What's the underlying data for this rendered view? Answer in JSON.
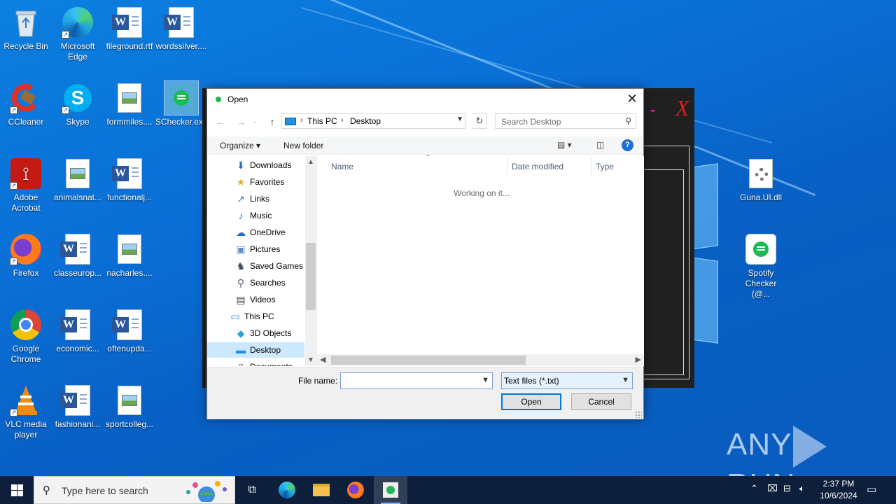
{
  "desktop": {
    "icons": [
      {
        "label": "Recycle Bin",
        "icon": "recycle-bin-icon"
      },
      {
        "label": "Microsoft Edge",
        "icon": "edge-icon"
      },
      {
        "label": "fileground.rtf",
        "icon": "word-doc-icon"
      },
      {
        "label": "wordssilver....",
        "icon": "word-doc-icon"
      },
      {
        "label": "CCleaner",
        "icon": "ccleaner-icon"
      },
      {
        "label": "Skype",
        "icon": "skype-icon"
      },
      {
        "label": "formmiles....",
        "icon": "image-file-icon"
      },
      {
        "label": "SChecker.exe",
        "icon": "spotify-checker-icon"
      },
      {
        "label": "Adobe Acrobat",
        "icon": "acrobat-icon"
      },
      {
        "label": "animalsnat...",
        "icon": "image-file-icon"
      },
      {
        "label": "functionalj...",
        "icon": "word-doc-icon"
      },
      {
        "label": "Firefox",
        "icon": "firefox-icon"
      },
      {
        "label": "classeurop...",
        "icon": "word-doc-icon"
      },
      {
        "label": "nacharles....",
        "icon": "image-file-icon"
      },
      {
        "label": "Google Chrome",
        "icon": "chrome-icon"
      },
      {
        "label": "economic...",
        "icon": "word-doc-icon"
      },
      {
        "label": "oftenupda...",
        "icon": "word-doc-icon"
      },
      {
        "label": "VLC media player",
        "icon": "vlc-icon"
      },
      {
        "label": "fashionani...",
        "icon": "word-doc-icon"
      },
      {
        "label": "sportcolleg...",
        "icon": "image-file-icon"
      },
      {
        "label": "Guna.UI.dll",
        "icon": "dll-gear-icon"
      },
      {
        "label": "Spotify Checker (@...",
        "icon": "spotify-checker-icon"
      }
    ]
  },
  "background_app": {
    "minimize_glyph": "-",
    "close_glyph": "X"
  },
  "dialog": {
    "title": "Open",
    "close_glyph": "✕",
    "nav": {
      "back": "←",
      "forward": "→",
      "recent": "⌄",
      "up": "↑",
      "refresh": "↻"
    },
    "address": {
      "crumbs": [
        "This PC",
        "Desktop"
      ],
      "sep": "›"
    },
    "search_placeholder": "Search Desktop",
    "toolbar": {
      "organize": "Organize ▾",
      "new_folder": "New folder",
      "help": "?"
    },
    "nav_items": [
      {
        "label": "Downloads",
        "icon": "downloads-icon",
        "glyph": "⬇",
        "color": "#1e6fd6",
        "indent": 1,
        "selected": false
      },
      {
        "label": "Favorites",
        "icon": "favorites-icon",
        "glyph": "★",
        "color": "#e8b21c",
        "indent": 1,
        "selected": false
      },
      {
        "label": "Links",
        "icon": "links-icon",
        "glyph": "↗",
        "color": "#2a7ad8",
        "indent": 1,
        "selected": false
      },
      {
        "label": "Music",
        "icon": "music-icon",
        "glyph": "♪",
        "color": "#1e6fd6",
        "indent": 1,
        "selected": false
      },
      {
        "label": "OneDrive",
        "icon": "onedrive-icon",
        "glyph": "☁",
        "color": "#1e6fd6",
        "indent": 1,
        "selected": false
      },
      {
        "label": "Pictures",
        "icon": "pictures-icon",
        "glyph": "▣",
        "color": "#5e8fc7",
        "indent": 1,
        "selected": false
      },
      {
        "label": "Saved Games",
        "icon": "saved-games-icon",
        "glyph": "♞",
        "color": "#3a4a5e",
        "indent": 1,
        "selected": false
      },
      {
        "label": "Searches",
        "icon": "searches-icon",
        "glyph": "⚲",
        "color": "#566577",
        "indent": 1,
        "selected": false
      },
      {
        "label": "Videos",
        "icon": "videos-icon",
        "glyph": "▤",
        "color": "#4a4a4a",
        "indent": 1,
        "selected": false
      },
      {
        "label": "This PC",
        "icon": "this-pc-icon",
        "glyph": "▭",
        "color": "#2a86e0",
        "indent": 0,
        "selected": false
      },
      {
        "label": "3D Objects",
        "icon": "3d-objects-icon",
        "glyph": "◆",
        "color": "#2aa5d8",
        "indent": 1,
        "selected": false
      },
      {
        "label": "Desktop",
        "icon": "desktop-folder-icon",
        "glyph": "▬",
        "color": "#1e8fe6",
        "indent": 1,
        "selected": true
      },
      {
        "label": "Documents",
        "icon": "documents-icon",
        "glyph": "▯",
        "color": "#5a6b80",
        "indent": 1,
        "selected": false
      }
    ],
    "columns": [
      "Name",
      "Date modified",
      "Type"
    ],
    "status_text": "Working on it...",
    "file_name_label": "File name:",
    "file_name_value": "",
    "file_type": "Text files  (*.txt)",
    "open_button": "Open",
    "cancel_button": "Cancel"
  },
  "watermark": {
    "left": "ANY",
    "right": "RUN"
  },
  "taskbar": {
    "search_placeholder": "Type here to search",
    "time": "2:37 PM",
    "date": "10/6/2024",
    "pinned": [
      "task-view-icon",
      "edge-icon",
      "file-explorer-icon",
      "firefox-icon",
      "spotify-checker-icon"
    ]
  },
  "colors": {
    "desktop_bg": "#0a6fd6",
    "taskbar_bg": "#0d1f3a",
    "selection": "#cce8ff",
    "accent": "#0078d7"
  }
}
